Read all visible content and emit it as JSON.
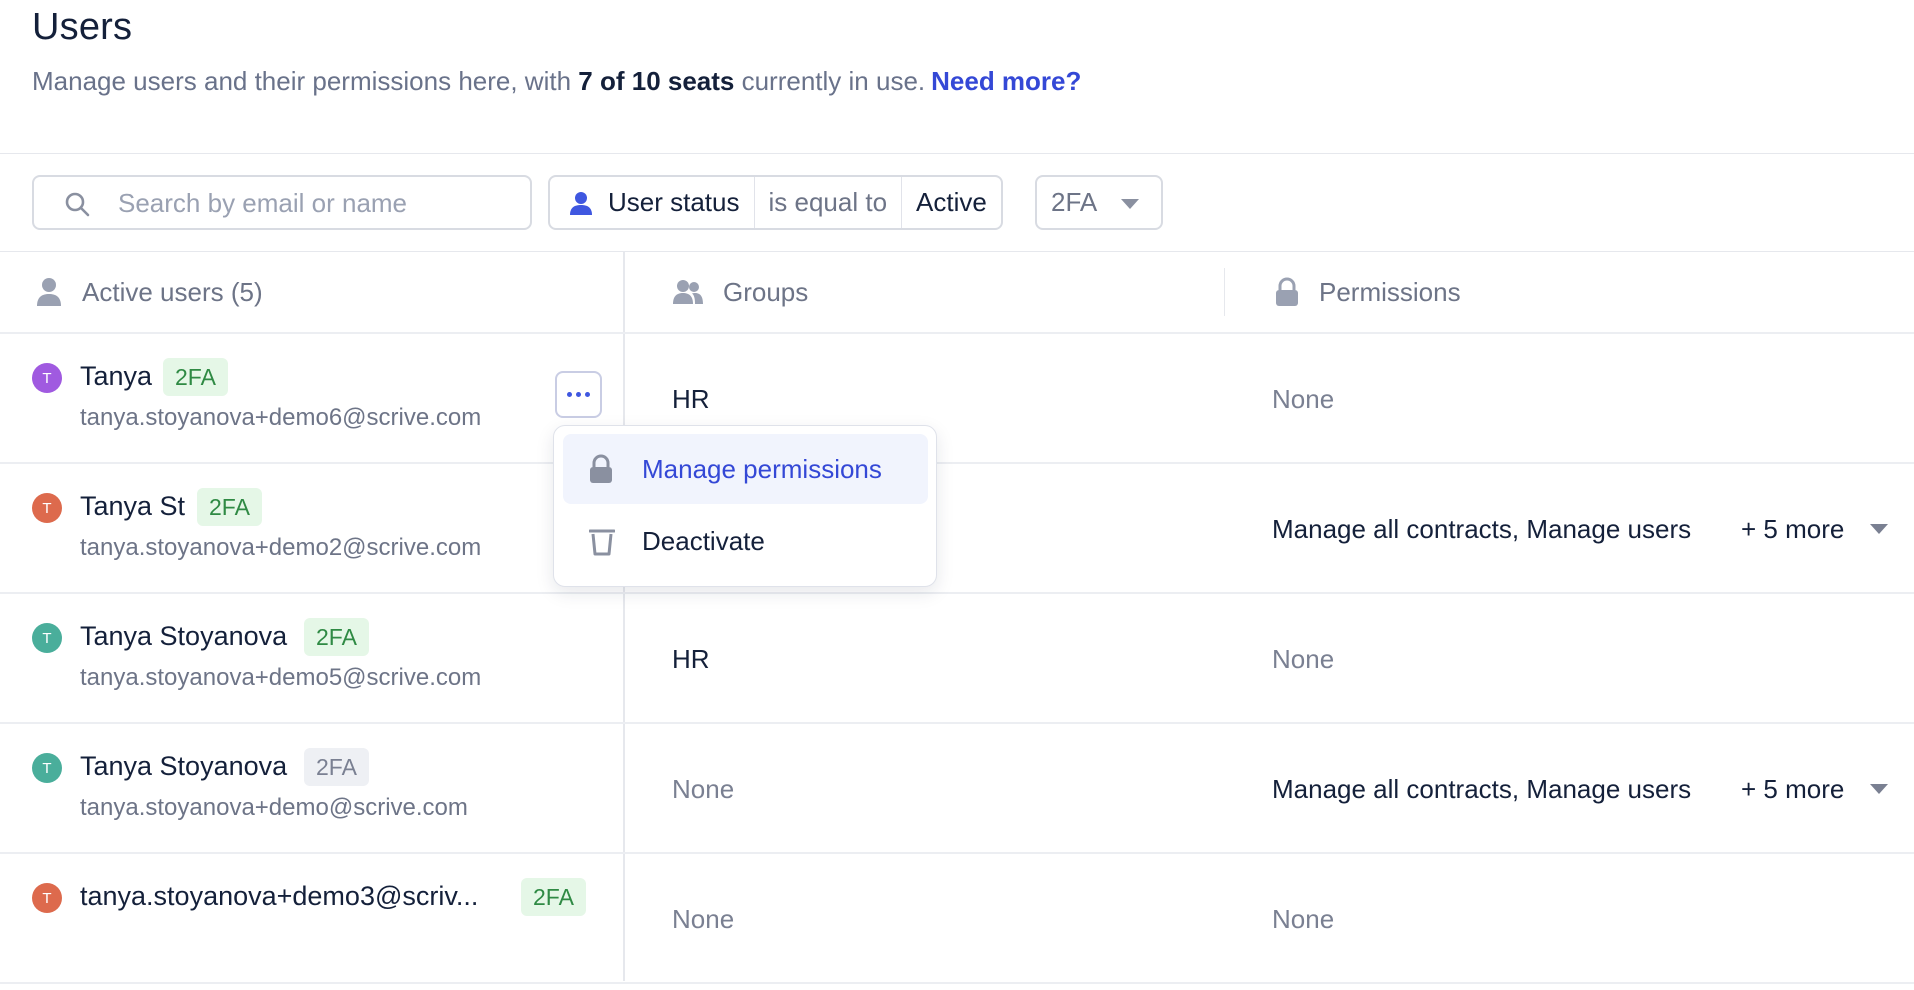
{
  "header": {
    "title": "Users",
    "subtitle_pre": "Manage users and their permissions here, with ",
    "subtitle_seats": "7 of 10 seats",
    "subtitle_post": " currently in use.",
    "need_more_link": "Need more?"
  },
  "filters": {
    "search_placeholder": "Search by email or name",
    "search_value": "",
    "status_filter": {
      "field": "User status",
      "operator": "is equal to",
      "value": "Active"
    },
    "tfa_dropdown": {
      "label": "2FA"
    }
  },
  "table": {
    "columns": {
      "users": "Active users (5)",
      "groups": "Groups",
      "permissions": "Permissions"
    },
    "rows": [
      {
        "initial": "T",
        "avatar_color": "#a05ae0",
        "name": "Tanya",
        "tfa": "2FA",
        "tfa_enabled": true,
        "email": "tanya.stoyanova+demo6@scrive.com",
        "groups": "HR",
        "permissions": "None",
        "more": ""
      },
      {
        "initial": "T",
        "avatar_color": "#dd6a4d",
        "name": "Tanya St",
        "tfa": "2FA",
        "tfa_enabled": true,
        "email": "tanya.stoyanova+demo2@scrive.com",
        "groups": "",
        "permissions": "Manage all contracts, Manage users",
        "more": "+ 5 more"
      },
      {
        "initial": "T",
        "avatar_color": "#4aae9b",
        "name": "Tanya Stoyanova",
        "tfa": "2FA",
        "tfa_enabled": true,
        "email": "tanya.stoyanova+demo5@scrive.com",
        "groups": "HR",
        "permissions": "None",
        "more": ""
      },
      {
        "initial": "T",
        "avatar_color": "#4aae9b",
        "name": "Tanya Stoyanova",
        "tfa": "2FA",
        "tfa_enabled": false,
        "email": "tanya.stoyanova+demo@scrive.com",
        "groups": "None",
        "permissions": "Manage all contracts, Manage users",
        "more": "+ 5 more"
      },
      {
        "initial": "T",
        "avatar_color": "#dd6a4d",
        "name": "tanya.stoyanova+demo3@scriv...",
        "tfa": "2FA",
        "tfa_enabled": true,
        "email": "",
        "groups": "None",
        "permissions": "None",
        "more": ""
      }
    ]
  },
  "row_menu": {
    "items": [
      {
        "label": "Manage permissions",
        "icon": "lock-icon"
      },
      {
        "label": "Deactivate",
        "icon": "trash-icon"
      }
    ]
  },
  "colors": {
    "accent": "#3448d6",
    "tfa_on_bg": "#e5f7e7",
    "tfa_on_text": "#2f8a44",
    "tfa_off_bg": "#eef0f4"
  }
}
